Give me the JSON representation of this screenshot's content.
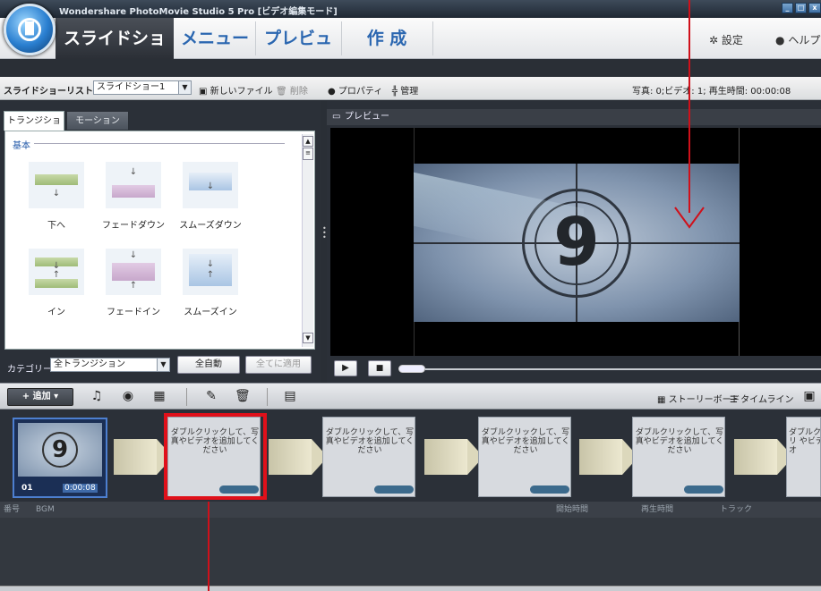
{
  "window": {
    "title": "Wondershare PhotoMovie Studio 5 Pro [ビデオ編集モード]",
    "controls": [
      "_",
      "□",
      "x"
    ]
  },
  "nav": {
    "tabs": [
      {
        "label": "スライドショー",
        "active": true
      },
      {
        "label": "メニュー",
        "active": false
      },
      {
        "label": "プレビュー",
        "active": false
      },
      {
        "label": "作 成",
        "active": false
      }
    ],
    "settings": "設定",
    "help": "ヘルプ"
  },
  "toolbar": {
    "list_label": "スライドショーリスト",
    "list_value": "スライドショー1",
    "new_file": "新しいファイル",
    "delete": "削除",
    "properties": "プロパティ",
    "manage": "管理",
    "status": "写真: 0;ビデオ: 1; 再生時間: 00:00:08"
  },
  "left_panel": {
    "tabs": {
      "transition": "トランジション",
      "motion": "モーション"
    },
    "group": "基本",
    "items": [
      {
        "label": "下へ",
        "icon": "down-transition-icon"
      },
      {
        "label": "フェードダウン",
        "icon": "fade-down-transition-icon"
      },
      {
        "label": "スムーズダウン",
        "icon": "smooth-down-transition-icon"
      },
      {
        "label": "イン",
        "icon": "in-transition-icon"
      },
      {
        "label": "フェードイン",
        "icon": "fade-in-transition-icon"
      },
      {
        "label": "スムーズイン",
        "icon": "smooth-in-transition-icon"
      }
    ],
    "category_label": "カテゴリー",
    "category_value": "全トランジション",
    "auto_button": "全自動",
    "apply_all_button": "全てに適用"
  },
  "preview": {
    "title": "プレビュー",
    "countdown_number": "9"
  },
  "bottom_toolbar": {
    "add": "追加",
    "storyboard": "ストーリーボード",
    "timeline": "タイムライン"
  },
  "storyboard": {
    "first_clip": {
      "index": "01",
      "duration": "0:00:08",
      "number": "9"
    },
    "placeholder_text": "ダブルクリックして、写真やビデオを追加してください",
    "placeholder_cut": "ダブルクリ やビデオ"
  },
  "info_header": {
    "number": "番号",
    "bgm": "BGM",
    "start_time": "開始時間",
    "play_time": "再生時間",
    "track": "トラック"
  },
  "colors": {
    "accent_blue": "#2a66b0",
    "annotation_red": "#e0101a",
    "dark_bg": "#2b3038"
  }
}
